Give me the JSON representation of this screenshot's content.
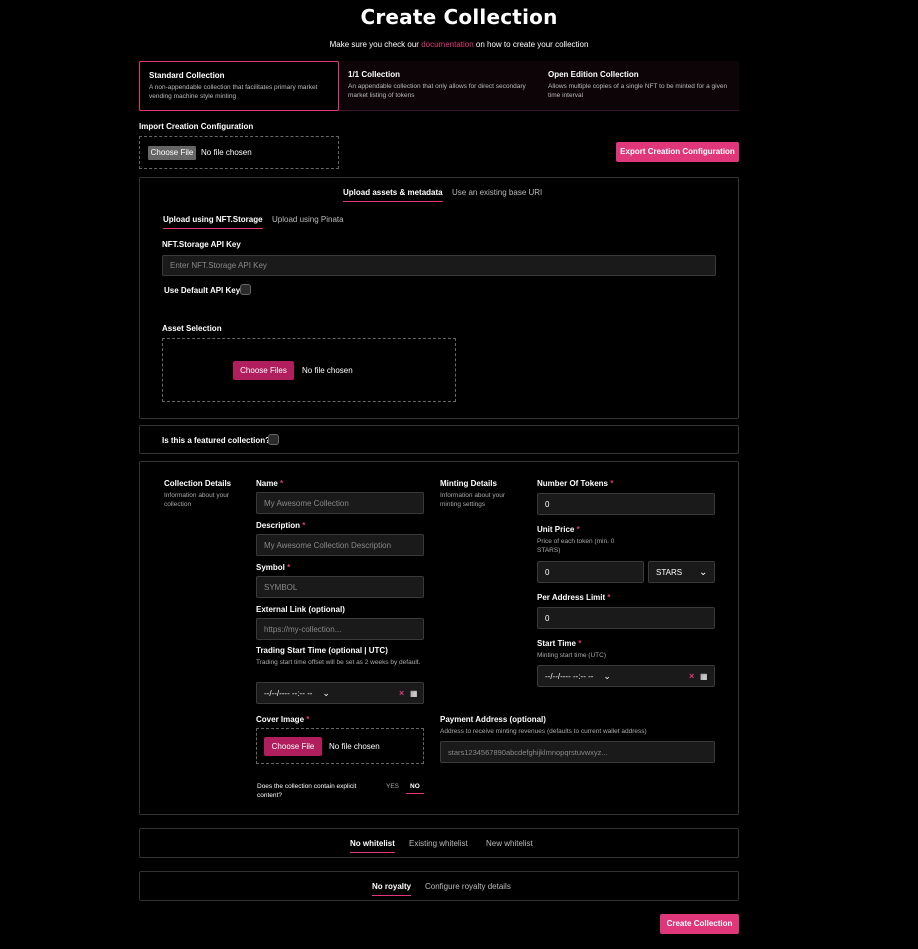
{
  "header": {
    "title": "Create Collection",
    "subtitle_pre": "Make sure you check our",
    "subtitle_link": "documentation",
    "subtitle_post": "on how to create your collection"
  },
  "collection_types": [
    {
      "title": "Standard Collection",
      "desc": "A non-appendable collection that facilitates primary market vending machine style minting"
    },
    {
      "title": "1/1 Collection",
      "desc": "An appendable collection that only allows for direct secondary market listing of tokens"
    },
    {
      "title": "Open Edition Collection",
      "desc": "Allows multiple copies of a single NFT to be minted for a given time interval"
    }
  ],
  "import": {
    "label": "Import Creation Configuration",
    "choose_file": "Choose File",
    "no_file": "No file chosen",
    "export_button": "Export Creation Configuration"
  },
  "upload": {
    "tabs": [
      "Upload assets & metadata",
      "Use an existing base URI"
    ],
    "subtabs": [
      "Upload using NFT.Storage",
      "Upload using Pinata"
    ],
    "api_key_label": "NFT.Storage API Key",
    "api_key_placeholder": "Enter NFT.Storage API Key",
    "default_key_label": "Use Default API Key",
    "asset_label": "Asset Selection",
    "choose_files": "Choose Files",
    "no_file": "No file chosen"
  },
  "featured": {
    "label": "Is this a featured collection?"
  },
  "collection_details": {
    "heading": "Collection Details",
    "desc": "Information about your collection",
    "name_label": "Name",
    "name_placeholder": "My Awesome Collection",
    "description_label": "Description",
    "description_placeholder": "My Awesome Collection Description",
    "symbol_label": "Symbol",
    "symbol_placeholder": "SYMBOL",
    "external_label": "External Link (optional)",
    "external_placeholder": "https://my-collection...",
    "trading_label": "Trading Start Time (optional | UTC)",
    "trading_desc": "Trading start time offset will be set as 2 weeks by default.",
    "trading_value": "--/--/---- --:-- --",
    "cover_label": "Cover Image",
    "cover_button": "Choose File",
    "cover_no_file": "No file chosen",
    "explicit_question": "Does the collection contain explicit content?",
    "yes": "YES",
    "no": "NO"
  },
  "minting_details": {
    "heading": "Minting Details",
    "desc": "Information about your minting settings",
    "tokens_label": "Number Of Tokens",
    "tokens_value": "0",
    "price_label": "Unit Price",
    "price_desc": "Price of each token (min. 0 STARS)",
    "price_value": "0",
    "currency": "STARS",
    "limit_label": "Per Address Limit",
    "limit_value": "0",
    "start_label": "Start Time",
    "start_desc": "Minting start time (UTC)",
    "start_value": "--/--/---- --:-- --",
    "payment_label": "Payment Address (optional)",
    "payment_desc": "Address to receive minting revenues (defaults to current wallet address)",
    "payment_placeholder": "stars1234567890abcdefghijklmnopqrstuvwxyz..."
  },
  "whitelist": {
    "tabs": [
      "No whitelist",
      "Existing whitelist",
      "New whitelist"
    ]
  },
  "royalty": {
    "tabs": [
      "No royalty",
      "Configure royalty details"
    ]
  },
  "submit": {
    "label": "Create Collection"
  },
  "colors": {
    "accent": "#e0367a",
    "background": "#000000"
  }
}
